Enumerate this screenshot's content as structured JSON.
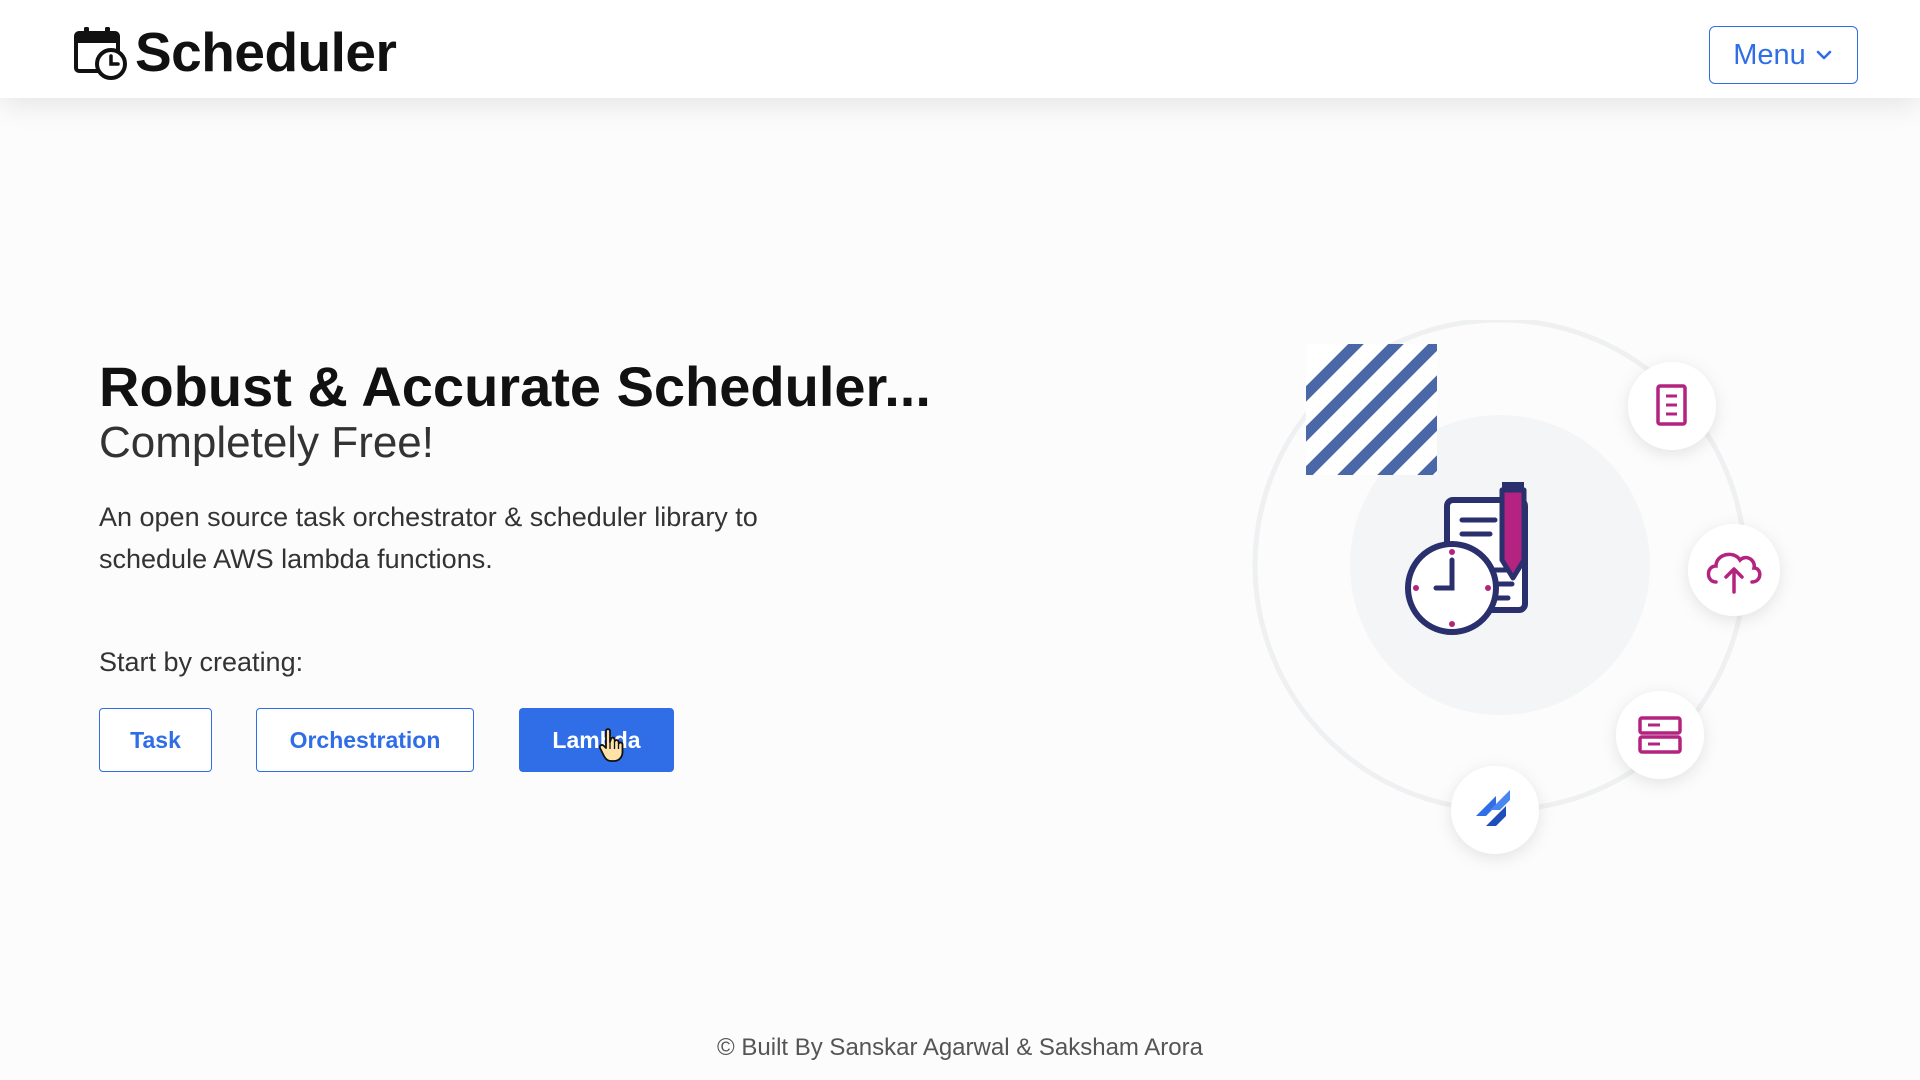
{
  "navbar": {
    "brand": "Scheduler",
    "brand_icon": "calendar-clock-icon",
    "menu_label": "Menu",
    "menu_icon": "chevron-down-icon"
  },
  "hero": {
    "title": "Robust & Accurate Scheduler...",
    "subtitle": "Completely Free!",
    "description": "An open source task orchestrator & scheduler library to schedule AWS lambda functions.",
    "start_label": "Start by creating:",
    "buttons": [
      {
        "label": "Task",
        "style": "outline"
      },
      {
        "label": "Orchestration",
        "style": "outline"
      },
      {
        "label": "Lambda",
        "style": "solid"
      }
    ]
  },
  "illustration": {
    "center_icon": "clock-document-pencil-icon",
    "orbit_icons": [
      "document-icon",
      "cloud-upload-icon",
      "server-icon",
      "jira-icon"
    ],
    "decoration": "striped-square"
  },
  "footer": {
    "text": "© Built By Sanskar Agarwal & Saksham Arora"
  },
  "colors": {
    "accent": "#2f6ee6",
    "magenta": "#b3237f",
    "navy": "#2a2f6e",
    "stripe": "#4a67a8",
    "background": "#fcfcfc"
  }
}
